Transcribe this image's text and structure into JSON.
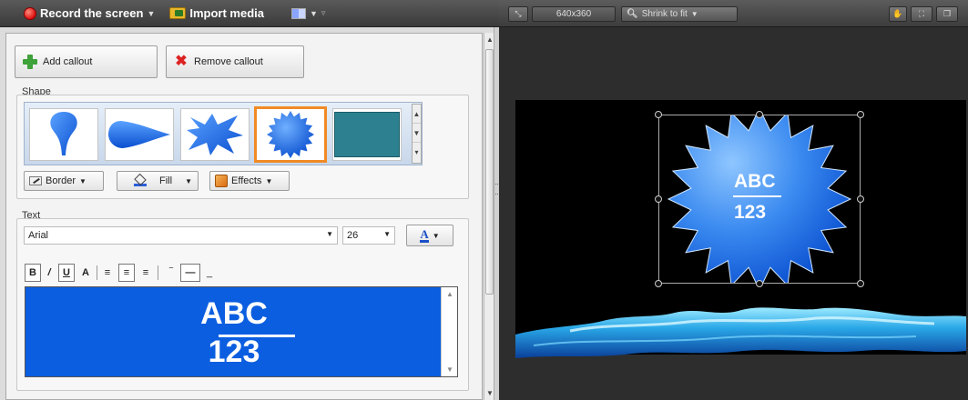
{
  "toolbar": {
    "record_label": "Record the screen",
    "import_label": "Import media"
  },
  "callout_buttons": {
    "add_label": "Add callout",
    "remove_label": "Remove callout"
  },
  "shape_section": {
    "label": "Shape",
    "shapes": [
      "teardrop-callout",
      "comet-callout",
      "burst-callout",
      "starburst-callout",
      "rectangle-callout"
    ],
    "selected": "starburst-callout",
    "border_label": "Border",
    "fill_label": "Fill",
    "effects_label": "Effects"
  },
  "text_section": {
    "label": "Text",
    "font": "Arial",
    "size": "26",
    "content_line1": "ABC",
    "content_line2": "123"
  },
  "preview_toolbar": {
    "resolution": "640x360",
    "zoom": "Shrink to fit"
  },
  "canvas": {
    "callout_line1": "ABC",
    "callout_line2": "123"
  },
  "colors": {
    "accent_selected": "#f08a24",
    "callout_blue": "#0c5ee0",
    "rectangle_shape": "#2c8090"
  }
}
